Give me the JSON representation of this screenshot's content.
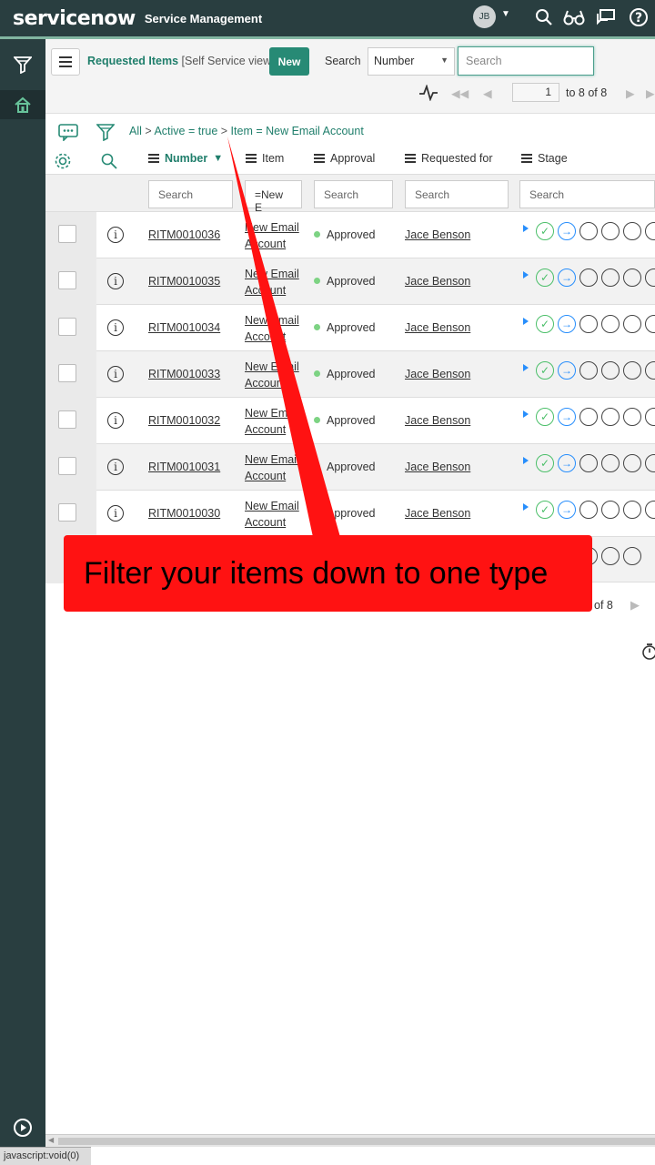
{
  "topbar": {
    "logo": "servicenow",
    "brand": "Service Management",
    "avatar_initials": "JB",
    "icons": [
      "search-icon",
      "glasses-icon",
      "chat-icon",
      "help-icon"
    ]
  },
  "header": {
    "title_primary": "Requested Items",
    "title_secondary": "[Self Service view]",
    "new_label": "New",
    "search_label": "Search",
    "search_field": "Number",
    "search_placeholder": "Search",
    "page_current": "1",
    "page_total_text": "to 8 of 8"
  },
  "breadcrumbs": [
    "All",
    "Active = true",
    "Item = New Email Account"
  ],
  "columns": {
    "number": "Number",
    "item": "Item",
    "approval": "Approval",
    "requested_for": "Requested for",
    "stage": "Stage"
  },
  "filters": {
    "number": "Search",
    "item": "=New E",
    "approval": "Search",
    "requested_for": "Search",
    "stage": "Search"
  },
  "rows": [
    {
      "number": "RITM0010036",
      "item": "New Email Account",
      "approval": "Approved",
      "requested_for": "Jace Benson"
    },
    {
      "number": "RITM0010035",
      "item": "New Email Account",
      "approval": "Approved",
      "requested_for": "Jace Benson"
    },
    {
      "number": "RITM0010034",
      "item": "New Email Account",
      "approval": "Approved",
      "requested_for": "Jace Benson"
    },
    {
      "number": "RITM0010033",
      "item": "New Email Account",
      "approval": "Approved",
      "requested_for": "Jace Benson"
    },
    {
      "number": "RITM0010032",
      "item": "New Email Account",
      "approval": "Approved",
      "requested_for": "Jace Benson"
    },
    {
      "number": "RITM0010031",
      "item": "New Email Account",
      "approval": "Approved",
      "requested_for": "Jace Benson"
    },
    {
      "number": "RITM0010030",
      "item": "New Email Account",
      "approval": "Approved",
      "requested_for": "Jace Benson"
    }
  ],
  "footer": {
    "page_total_text": "of 8"
  },
  "callout": "Filter your items down to one type",
  "statusbar": "javascript:void(0)"
}
